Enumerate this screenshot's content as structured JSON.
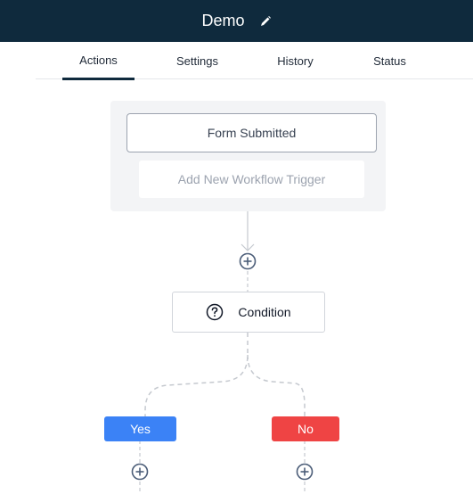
{
  "header": {
    "title": "Demo",
    "edit_icon": "pencil-icon"
  },
  "tabs": [
    {
      "label": "Actions",
      "active": true
    },
    {
      "label": "Settings",
      "active": false
    },
    {
      "label": "History",
      "active": false
    },
    {
      "label": "Status",
      "active": false
    }
  ],
  "workflow": {
    "trigger": {
      "label": "Form Submitted"
    },
    "add_trigger": {
      "label": "Add New Workflow Trigger"
    },
    "condition": {
      "label": "Condition",
      "icon": "question-circle-icon"
    },
    "branches": {
      "yes": {
        "label": "Yes",
        "color": "#3b82f6"
      },
      "no": {
        "label": "No",
        "color": "#ef4444"
      }
    },
    "add_step_icon": "plus-circle-icon"
  },
  "colors": {
    "header_bg": "#0f2a3d",
    "panel_bg": "#f3f4f6"
  }
}
